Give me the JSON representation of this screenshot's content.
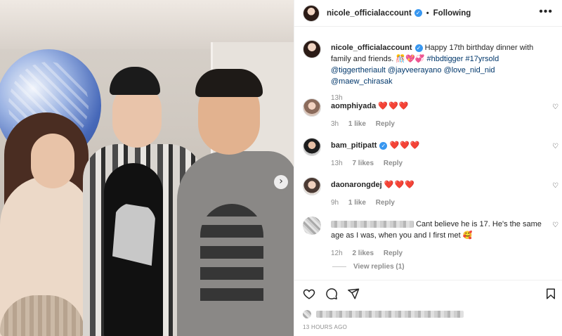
{
  "header": {
    "username": "nicole_officialaccount",
    "separator": "•",
    "follow_status": "Following",
    "more_glyph": "•••"
  },
  "photo": {
    "next_glyph": "›"
  },
  "caption": {
    "username": "nicole_officialaccount",
    "text": "Happy 17th birthday dinner with family and friends. 🎊💖💞 ",
    "tags": [
      "#hbdtigger",
      "#17yrsold",
      "@tiggertheriault",
      "@jayveerayano",
      "@love_nid_nid",
      "@maew_chirasak"
    ],
    "time": "13h"
  },
  "comments": [
    {
      "username": "aomphiyada",
      "text": "❤️❤️❤️",
      "time": "3h",
      "likes": "1 like",
      "reply": "Reply",
      "verified": false
    },
    {
      "username": "bam_pitipatt",
      "text": "❤️❤️❤️",
      "time": "13h",
      "likes": "7 likes",
      "reply": "Reply",
      "verified": true
    },
    {
      "username": "daonarongdej",
      "text": "❤️❤️❤️",
      "time": "9h",
      "likes": "1 like",
      "reply": "Reply",
      "verified": false
    },
    {
      "username": "",
      "text": "Cant believe he is 17. He's the same age as I was, when you and I first met 🥰",
      "time": "12h",
      "likes": "2 likes",
      "reply": "Reply",
      "verified": false
    }
  ],
  "view_replies": "View replies (1)",
  "footer": {
    "timestamp": "13 HOURS AGO"
  },
  "icons": {
    "like": "heart-icon",
    "comment": "comment-icon",
    "share": "share-icon",
    "save": "bookmark-icon",
    "verified": "verified-badge-icon"
  },
  "colors": {
    "verified": "#3897f0",
    "link": "#00376b",
    "muted": "#8e8e8e",
    "heart": "#e0245e"
  }
}
